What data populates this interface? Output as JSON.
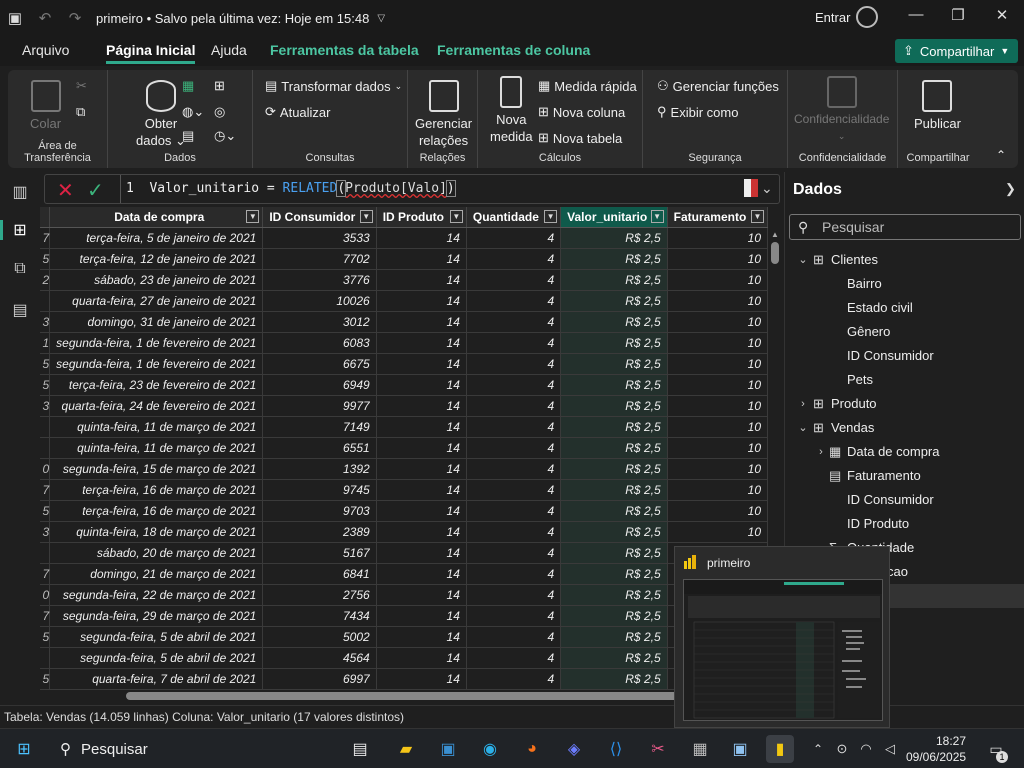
{
  "titlebar": {
    "doc_title": "primeiro • Salvo pela última vez: Hoje em 15:48",
    "signin": "Entrar"
  },
  "menu": {
    "items": [
      "Arquivo",
      "Página Inicial",
      "Ajuda",
      "Ferramentas da tabela",
      "Ferramentas de coluna"
    ],
    "share": "Compartilhar"
  },
  "ribbon": {
    "colar": "Colar",
    "area_label": "Área de Transferência",
    "obter": "Obter",
    "dados_btn": "dados",
    "dados_label": "Dados",
    "transformar": "Transformar dados",
    "atualizar": "Atualizar",
    "consultas_label": "Consultas",
    "gerenciar": "Gerenciar",
    "relacoes": "relações",
    "relacoes_label": "Relações",
    "nova": "Nova",
    "medida": "medida",
    "medida_rapida": "Medida rápida",
    "nova_coluna": "Nova coluna",
    "nova_tabela": "Nova tabela",
    "calculos_label": "Cálculos",
    "gerenciar_funcoes": "Gerenciar funções",
    "exibir_como": "Exibir como",
    "seguranca_label": "Segurança",
    "confidencialidade_btn": "Confidencialidade",
    "confidencialidade_label": "Confidencialidade",
    "publicar": "Publicar",
    "compartilhar_label": "Compartilhar"
  },
  "formula": {
    "line_no": "1",
    "prefix": "Valor_unitario = ",
    "fn": "RELATED",
    "open": "(",
    "ref": "Produto[Valo]",
    "close": ")"
  },
  "table": {
    "headers": [
      "Data de compra",
      "ID Consumidor",
      "ID Produto",
      "Quantidade",
      "Valor_unitario",
      "Faturamento"
    ],
    "rows": [
      [
        "7",
        "terça-feira, 5 de janeiro de 2021",
        "3533",
        "14",
        "4",
        "R$ 2,5",
        "10"
      ],
      [
        "5",
        "terça-feira, 12 de janeiro de 2021",
        "7702",
        "14",
        "4",
        "R$ 2,5",
        "10"
      ],
      [
        "2",
        "sábado, 23 de janeiro de 2021",
        "3776",
        "14",
        "4",
        "R$ 2,5",
        "10"
      ],
      [
        "",
        "quarta-feira, 27 de janeiro de 2021",
        "10026",
        "14",
        "4",
        "R$ 2,5",
        "10"
      ],
      [
        "3",
        "domingo, 31 de janeiro de 2021",
        "3012",
        "14",
        "4",
        "R$ 2,5",
        "10"
      ],
      [
        "1",
        "segunda-feira, 1 de fevereiro de 2021",
        "6083",
        "14",
        "4",
        "R$ 2,5",
        "10"
      ],
      [
        "5",
        "segunda-feira, 1 de fevereiro de 2021",
        "6675",
        "14",
        "4",
        "R$ 2,5",
        "10"
      ],
      [
        "5",
        "terça-feira, 23 de fevereiro de 2021",
        "6949",
        "14",
        "4",
        "R$ 2,5",
        "10"
      ],
      [
        "3",
        "quarta-feira, 24 de fevereiro de 2021",
        "9977",
        "14",
        "4",
        "R$ 2,5",
        "10"
      ],
      [
        "",
        "quinta-feira, 11 de março de 2021",
        "7149",
        "14",
        "4",
        "R$ 2,5",
        "10"
      ],
      [
        "",
        "quinta-feira, 11 de março de 2021",
        "6551",
        "14",
        "4",
        "R$ 2,5",
        "10"
      ],
      [
        "0",
        "segunda-feira, 15 de março de 2021",
        "1392",
        "14",
        "4",
        "R$ 2,5",
        "10"
      ],
      [
        "7",
        "terça-feira, 16 de março de 2021",
        "9745",
        "14",
        "4",
        "R$ 2,5",
        "10"
      ],
      [
        "5",
        "terça-feira, 16 de março de 2021",
        "9703",
        "14",
        "4",
        "R$ 2,5",
        "10"
      ],
      [
        "3",
        "quinta-feira, 18 de março de 2021",
        "2389",
        "14",
        "4",
        "R$ 2,5",
        "10"
      ],
      [
        "",
        "sábado, 20 de março de 2021",
        "5167",
        "14",
        "4",
        "R$ 2,5",
        "10"
      ],
      [
        "7",
        "domingo, 21 de março de 2021",
        "6841",
        "14",
        "4",
        "R$ 2,5",
        "10"
      ],
      [
        "0",
        "segunda-feira, 22 de março de 2021",
        "2756",
        "14",
        "4",
        "R$ 2,5",
        "10"
      ],
      [
        "7",
        "segunda-feira, 29 de março de 2021",
        "7434",
        "14",
        "4",
        "R$ 2,5",
        "10"
      ],
      [
        "5",
        "segunda-feira, 5 de abril de 2021",
        "5002",
        "14",
        "4",
        "R$ 2,5",
        "10"
      ],
      [
        "",
        "segunda-feira, 5 de abril de 2021",
        "4564",
        "14",
        "4",
        "R$ 2,5",
        "10"
      ],
      [
        "5",
        "quarta-feira, 7 de abril de 2021",
        "6997",
        "14",
        "4",
        "R$ 2,5",
        "10"
      ]
    ]
  },
  "dados_pane": {
    "title": "Dados",
    "search_placeholder": "Pesquisar",
    "nodes": [
      {
        "label": "Clientes",
        "level": 0,
        "expanded": true,
        "icon": "table-icon"
      },
      {
        "label": "Bairro",
        "level": 1,
        "icon": ""
      },
      {
        "label": "Estado civil",
        "level": 1,
        "icon": ""
      },
      {
        "label": "Gênero",
        "level": 1,
        "icon": ""
      },
      {
        "label": "ID Consumidor",
        "level": 1,
        "icon": ""
      },
      {
        "label": "Pets",
        "level": 1,
        "icon": ""
      },
      {
        "label": "Produto",
        "level": 0,
        "expanded": false,
        "icon": "table-icon"
      },
      {
        "label": "Vendas",
        "level": 0,
        "expanded": true,
        "icon": "table-icon"
      },
      {
        "label": "Data de compra",
        "level": 1,
        "expandable": true,
        "icon": "calendar-icon"
      },
      {
        "label": "Faturamento",
        "level": 1,
        "icon": "calc-column-icon"
      },
      {
        "label": "ID Consumidor",
        "level": 1,
        "icon": ""
      },
      {
        "label": "ID Produto",
        "level": 1,
        "icon": ""
      },
      {
        "label": "Quantidade",
        "level": 1,
        "icon": "sigma-icon"
      },
      {
        "label": "Transacao",
        "level": 1,
        "icon": "sigma-icon"
      },
      {
        "label": "nitario",
        "level": 1,
        "icon": "",
        "selected": true
      }
    ]
  },
  "status": "Tabela: Vendas (14.059 linhas) Coluna: Valor_unitario (17 valores distintos)",
  "taskbar": {
    "search": "Pesquisar",
    "time": "18:27",
    "date": "09/06/2025",
    "notif_count": "1"
  },
  "popup": {
    "title": "primeiro"
  },
  "colors": {
    "accent": "#2fa98c",
    "share_bg": "#0f6b58",
    "highlight_col": "#0f5a4b"
  }
}
